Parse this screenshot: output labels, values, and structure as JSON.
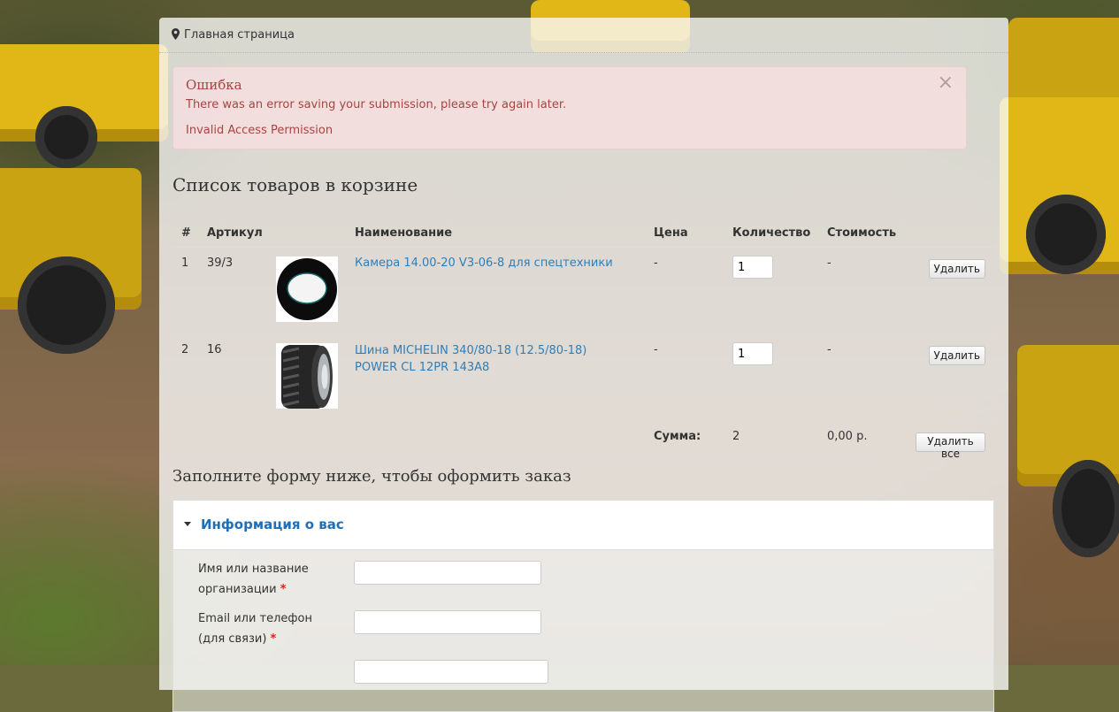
{
  "breadcrumb": {
    "home": "Главная страница"
  },
  "alert": {
    "title": "Ошибка",
    "message": "There was an error saving your submission, please try again later.",
    "detail": "Invalid Access Permission",
    "close_glyph": "×"
  },
  "cart": {
    "heading": "Список товаров в корзине",
    "columns": [
      "#",
      "Артикул",
      "Наименование",
      "Цена",
      "Количество",
      "Стоимость"
    ],
    "items": [
      {
        "num": "1",
        "sku": "39/3",
        "name": "Камера 14.00-20 V3-06-8 для спецтехники",
        "price": "-",
        "qty": "1",
        "cost": "-",
        "remove": "Удалить",
        "image": "inner-tube-icon"
      },
      {
        "num": "2",
        "sku": "16",
        "name": "Шина MICHELIN 340/80-18 (12.5/80-18) POWER CL 12PR 143A8",
        "price": "-",
        "qty": "1",
        "cost": "-",
        "remove": "Удалить",
        "image": "tire-icon"
      }
    ],
    "total_label": "Сумма:",
    "total_qty": "2",
    "total_cost": "0,00 р.",
    "remove_all": "Удалить все"
  },
  "form": {
    "heading": "Заполните форму ниже, чтобы оформить заказ",
    "section_title": "Информация о вас",
    "fields": [
      {
        "label_line1": "Имя или название",
        "label_line2": "организации",
        "required": "*",
        "value": ""
      },
      {
        "label_line1": "Email или телефон",
        "label_line2": "(для связи)",
        "required": "*",
        "value": ""
      }
    ]
  },
  "colors": {
    "link": "#2f7eb8",
    "section_title": "#1f6fb8",
    "alert_text": "#a94442",
    "alert_bg": "#f2dede",
    "required": "#dd1111"
  }
}
